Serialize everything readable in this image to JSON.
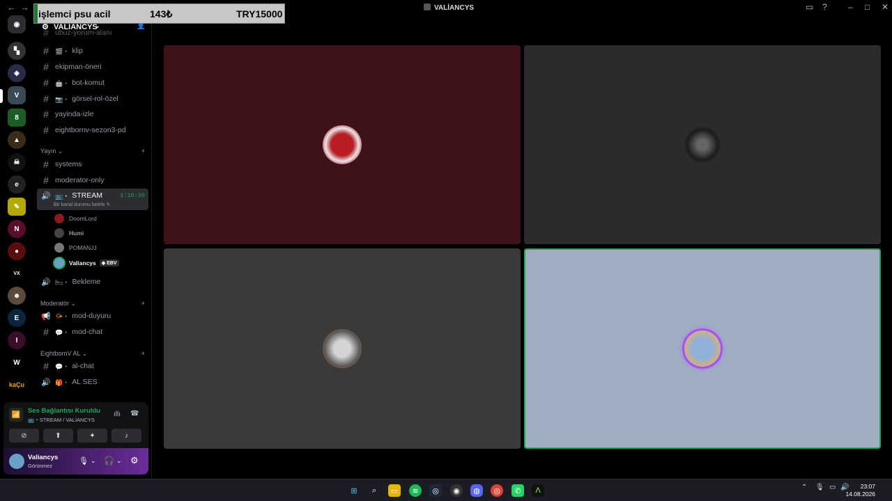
{
  "window": {
    "title": "VALİANCYS"
  },
  "overlay": {
    "item": "işlemci psu acil",
    "price_a": "143₺",
    "price_b": "TRY15000"
  },
  "server": {
    "name": "VALİANCYS"
  },
  "channels": {
    "partial_top": "ubuz-yorum-alanı",
    "klip": "klip",
    "ekipman": "ekipman-öneri",
    "bot": "bot-komut",
    "gorsel": "görsel-rol-özel",
    "yayinda": "yayinda-izle",
    "eightborn": "eightbornv-sezon3-pd"
  },
  "categories": {
    "yayin": "Yayın",
    "moderator": "Moderatör",
    "eightborn_al": "EightbornV AL"
  },
  "yayin_channels": {
    "systems": "systems",
    "moderator_only": "moderator-only",
    "stream": "STREAM",
    "stream_timer": "1:10:30",
    "stream_status": "Bir kanal durumu belirle",
    "bekleme": "Bekleme"
  },
  "voice_users": [
    {
      "name": "DoomLord",
      "color": "#8b1a1a"
    },
    {
      "name": "Humi",
      "color": "#444444"
    },
    {
      "name": "POMANJJ",
      "color": "#777777"
    },
    {
      "name": "Valiancys",
      "color": "#6aa0c8",
      "badge": "EBV"
    }
  ],
  "mod_channels": {
    "duyuru": "mod-duyuru",
    "chat": "mod-chat"
  },
  "al_channels": {
    "chat": "al-chat",
    "ses": "AL SES"
  },
  "voice_panel": {
    "status": "Ses Bağlantısı Kuruldu",
    "location": "STREAM / VALİANCYS",
    "status_color": "#23a559"
  },
  "user": {
    "name": "Valiancys",
    "status": "Görünmez"
  },
  "tiles": [
    {
      "bg": "#3f1219",
      "avatar_color": "#b81d24",
      "avatar_name": "spiderman-avatar"
    },
    {
      "bg": "#2b2b2b",
      "avatar_color": "#3a3a3a",
      "avatar_name": "user-avatar"
    },
    {
      "bg": "#3a3a3a",
      "avatar_color": "#d4d4d4",
      "avatar_name": "lion-avatar"
    },
    {
      "bg": "#a0aec4",
      "avatar_color": "#8fb0d8",
      "avatar_name": "self-avatar",
      "speaking_color": "#23a559"
    }
  ],
  "clock": {
    "time": "23:07",
    "date": "14.08.2026"
  }
}
